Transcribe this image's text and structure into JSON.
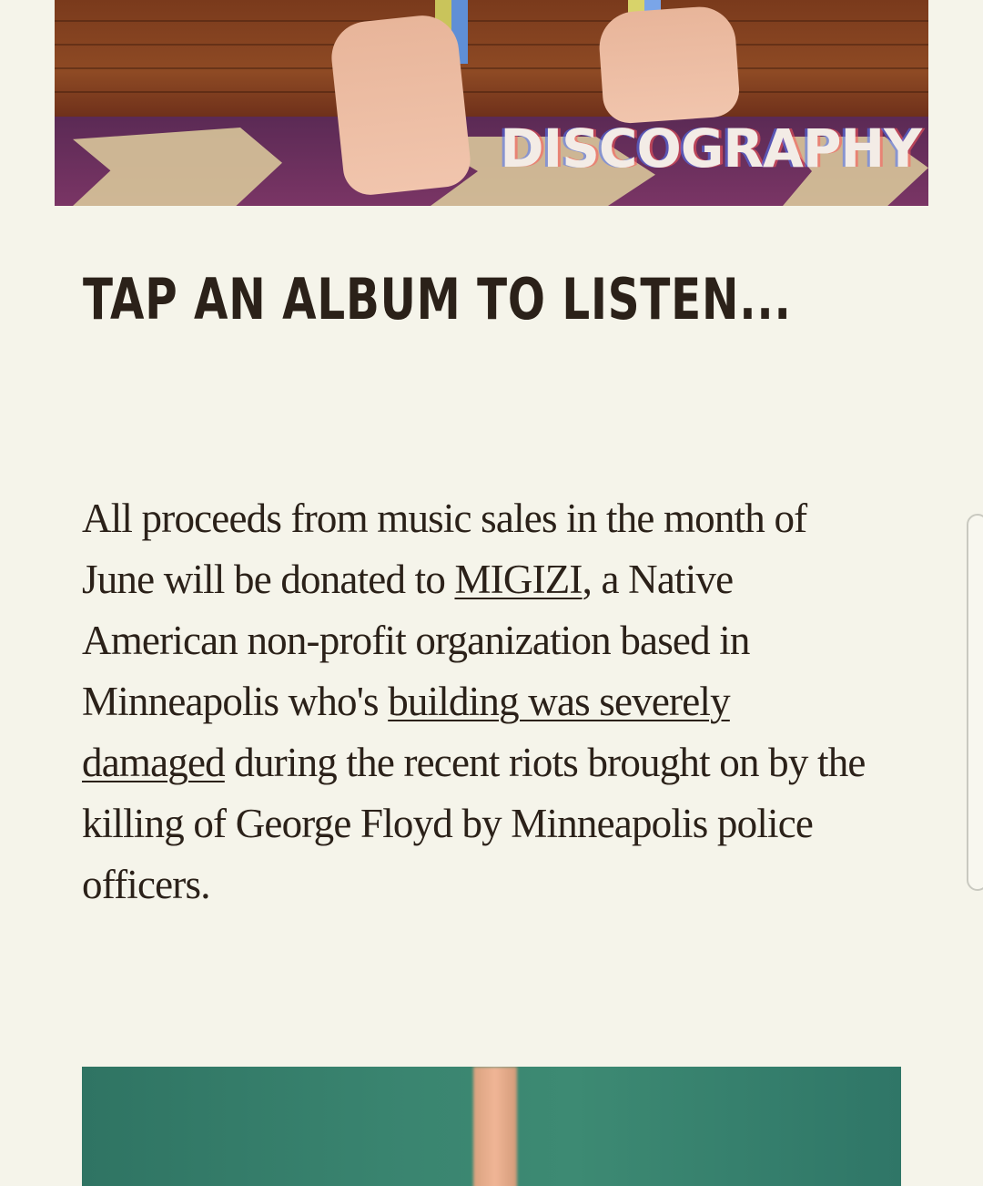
{
  "hero": {
    "title": "DISCOGRAPHY"
  },
  "main": {
    "heading": "TAP AN ALBUM TO LISTEN...",
    "notice": {
      "part1": "All proceeds from music sales in the month of June will be donated to ",
      "link1": "MIGIZI",
      "part2": ", a Native American non-profit organization based in Minneapolis who's ",
      "link2": "building was severely damaged",
      "part3": " during the recent riots brought on by the killing of George Floyd by Minneapolis police officers."
    }
  },
  "colors": {
    "background": "#f5f4ea",
    "text": "#2b2119",
    "album_green": "#3a8570"
  }
}
